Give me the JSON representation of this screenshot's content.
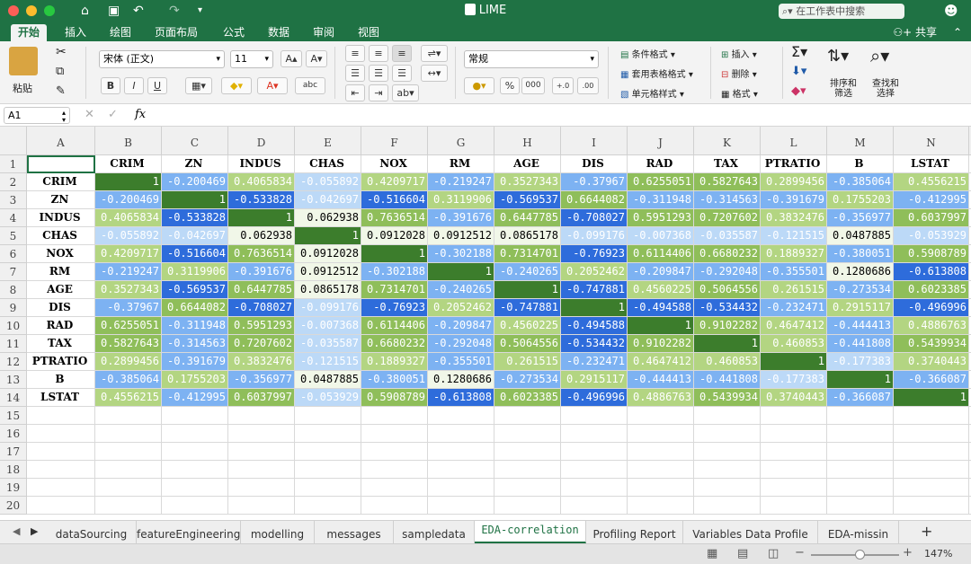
{
  "window": {
    "title": "LIME",
    "search_placeholder": "在工作表中搜索"
  },
  "ribbon_tabs": [
    "开始",
    "插入",
    "绘图",
    "页面布局",
    "公式",
    "数据",
    "审阅",
    "视图"
  ],
  "share_label": "共享",
  "ribbon": {
    "paste_label": "粘贴",
    "font_name": "宋体 (正文)",
    "font_size": "11",
    "number_format": "常规",
    "conditional_format": "条件格式",
    "table_format": "套用表格格式",
    "cell_style": "单元格样式",
    "insert": "插入",
    "delete": "删除",
    "format": "格式",
    "sort_filter": "排序和\n筛选",
    "find_select": "查找和\n选择",
    "bold": "B",
    "italic": "I",
    "underline": "U",
    "percent": "%",
    "thousands": "000"
  },
  "formula_bar": {
    "name_box": "A1",
    "fx": "fx",
    "content": ""
  },
  "columns": [
    "A",
    "B",
    "C",
    "D",
    "E",
    "F",
    "G",
    "H",
    "I",
    "J",
    "K",
    "L",
    "M",
    "N"
  ],
  "row_count": 20,
  "headers": [
    "CRIM",
    "ZN",
    "INDUS",
    "CHAS",
    "NOX",
    "RM",
    "AGE",
    "DIS",
    "RAD",
    "TAX",
    "PTRATIO",
    "B",
    "LSTAT"
  ],
  "matrix": [
    [
      "1",
      "-0.200469",
      "0.4065834",
      "-0.055892",
      "0.4209717",
      "-0.219247",
      "0.3527343",
      "-0.37967",
      "0.6255051",
      "0.5827643",
      "0.2899456",
      "-0.385064",
      "0.4556215"
    ],
    [
      "-0.200469",
      "1",
      "-0.533828",
      "-0.042697",
      "-0.516604",
      "0.3119906",
      "-0.569537",
      "0.6644082",
      "-0.311948",
      "-0.314563",
      "-0.391679",
      "0.1755203",
      "-0.412995"
    ],
    [
      "0.4065834",
      "-0.533828",
      "1",
      "0.062938",
      "0.7636514",
      "-0.391676",
      "0.6447785",
      "-0.708027",
      "0.5951293",
      "0.7207602",
      "0.3832476",
      "-0.356977",
      "0.6037997"
    ],
    [
      "-0.055892",
      "-0.042697",
      "0.062938",
      "1",
      "0.0912028",
      "0.0912512",
      "0.0865178",
      "-0.099176",
      "-0.007368",
      "-0.035587",
      "-0.121515",
      "0.0487885",
      "-0.053929"
    ],
    [
      "0.4209717",
      "-0.516604",
      "0.7636514",
      "0.0912028",
      "1",
      "-0.302188",
      "0.7314701",
      "-0.76923",
      "0.6114406",
      "0.6680232",
      "0.1889327",
      "-0.380051",
      "0.5908789"
    ],
    [
      "-0.219247",
      "0.3119906",
      "-0.391676",
      "0.0912512",
      "-0.302188",
      "1",
      "-0.240265",
      "0.2052462",
      "-0.209847",
      "-0.292048",
      "-0.355501",
      "0.1280686",
      "-0.613808"
    ],
    [
      "0.3527343",
      "-0.569537",
      "0.6447785",
      "0.0865178",
      "0.7314701",
      "-0.240265",
      "1",
      "-0.747881",
      "0.4560225",
      "0.5064556",
      "0.261515",
      "-0.273534",
      "0.6023385"
    ],
    [
      "-0.37967",
      "0.6644082",
      "-0.708027",
      "-0.099176",
      "-0.76923",
      "0.2052462",
      "-0.747881",
      "1",
      "-0.494588",
      "-0.534432",
      "-0.232471",
      "0.2915117",
      "-0.496996"
    ],
    [
      "0.6255051",
      "-0.311948",
      "0.5951293",
      "-0.007368",
      "0.6114406",
      "-0.209847",
      "0.4560225",
      "-0.494588",
      "1",
      "0.9102282",
      "0.4647412",
      "-0.444413",
      "0.4886763"
    ],
    [
      "0.5827643",
      "-0.314563",
      "0.7207602",
      "-0.035587",
      "0.6680232",
      "-0.292048",
      "0.5064556",
      "-0.534432",
      "0.9102282",
      "1",
      "0.460853",
      "-0.441808",
      "0.5439934"
    ],
    [
      "0.2899456",
      "-0.391679",
      "0.3832476",
      "-0.121515",
      "0.1889327",
      "-0.355501",
      "0.261515",
      "-0.232471",
      "0.4647412",
      "0.460853",
      "1",
      "-0.177383",
      "0.3740443"
    ],
    [
      "-0.385064",
      "0.1755203",
      "-0.356977",
      "0.0487885",
      "-0.380051",
      "0.1280686",
      "-0.273534",
      "0.2915117",
      "-0.444413",
      "-0.441808",
      "-0.177383",
      "1",
      "-0.366087"
    ],
    [
      "0.4556215",
      "-0.412995",
      "0.6037997",
      "-0.053929",
      "0.5908789",
      "-0.613808",
      "0.6023385",
      "-0.496996",
      "0.4886763",
      "0.5439934",
      "0.3740443",
      "-0.366087",
      "1"
    ]
  ],
  "sheet_tabs": [
    "dataSourcing",
    "featureEngineering",
    "modelling",
    "messages",
    "sampledata",
    "EDA-correlation",
    "Profiling Report",
    "Variables Data Profile",
    "EDA-missin"
  ],
  "active_sheet": "EDA-correlation",
  "add_sheet": "+",
  "zoom": "147%",
  "colors": {
    "accent": "#1f7244",
    "pos_high": "#3c7d2c",
    "pos_mid": "#8fbe5a",
    "neg_high": "#2e6cdb",
    "neg_mid": "#7db2f2"
  }
}
